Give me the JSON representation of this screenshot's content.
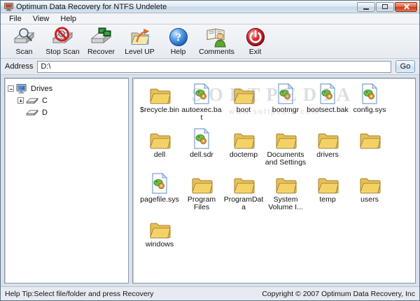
{
  "window": {
    "title": "Optimum Data Recovery for NTFS Undelete"
  },
  "menu": {
    "items": [
      {
        "label": "File"
      },
      {
        "label": "View"
      },
      {
        "label": "Help"
      }
    ]
  },
  "toolbar": {
    "buttons": [
      {
        "label": "Scan",
        "icon": "scan-icon"
      },
      {
        "label": "Stop Scan",
        "icon": "stop-scan-icon"
      },
      {
        "label": "Recover",
        "icon": "recover-icon"
      },
      {
        "label": "Level UP",
        "icon": "level-up-icon"
      },
      {
        "label": "Help",
        "icon": "help-icon"
      },
      {
        "label": "Comments",
        "icon": "comments-icon"
      },
      {
        "label": "Exit",
        "icon": "exit-icon"
      }
    ]
  },
  "address_bar": {
    "label": "Address",
    "value": "D:\\",
    "go_label": "Go"
  },
  "tree": {
    "root": {
      "label": "Drives",
      "expander": "minus",
      "icon": "computer-icon"
    },
    "children": [
      {
        "label": "C",
        "expander": "plus",
        "icon": "drive-icon"
      },
      {
        "label": "D",
        "expander": "none",
        "icon": "drive-icon"
      }
    ]
  },
  "file_grid": {
    "items": [
      {
        "name": "$recycle.bin",
        "type": "folder"
      },
      {
        "name": "autoexec.bat",
        "type": "sysfile"
      },
      {
        "name": "boot",
        "type": "folder"
      },
      {
        "name": "bootmgr",
        "type": "sysfile"
      },
      {
        "name": "bootsect.bak",
        "type": "sysfile"
      },
      {
        "name": "config.sys",
        "type": "sysfile"
      },
      {
        "name": "dell",
        "type": "folder"
      },
      {
        "name": "dell.sdr",
        "type": "sysfile"
      },
      {
        "name": "doctemp",
        "type": "folder"
      },
      {
        "name": "Documents and Settings",
        "type": "folder"
      },
      {
        "name": "drivers",
        "type": "folder"
      },
      {
        "name": "",
        "type": "folder"
      },
      {
        "name": "pagefile.sys",
        "type": "sysfile"
      },
      {
        "name": "Program Files",
        "type": "folder"
      },
      {
        "name": "ProgramData",
        "type": "folder"
      },
      {
        "name": "System Volume I...",
        "type": "folder"
      },
      {
        "name": "temp",
        "type": "folder"
      },
      {
        "name": "users",
        "type": "folder"
      },
      {
        "name": "windows",
        "type": "folder"
      }
    ]
  },
  "watermark": {
    "line1": "SOFTPEDIA",
    "line2": "www.softpedia.com"
  },
  "status_bar": {
    "left": "Help Tip:Select file/folder and press Recovery",
    "right": "Copyright © 2007 Optimum Data Recovery, Inc"
  },
  "colors": {
    "titlebar_gradient_top": "#f4f8fb",
    "titlebar_gradient_bottom": "#d6e2ee",
    "frame": "#c2d3e2",
    "panel_border": "#8a98a6",
    "folder_yellow": "#f3d163",
    "close_button_red": "#c63a1c",
    "help_sphere_blue": "#2878d0",
    "exit_sphere_red": "#c01828"
  }
}
